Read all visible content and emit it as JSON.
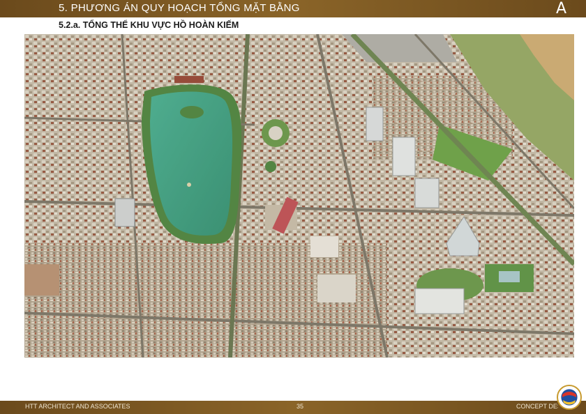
{
  "header": {
    "section_title": "5. PHƯƠNG ÁN QUY HOẠCH TỔNG MẶT BẰNG",
    "logo_letter": "A"
  },
  "subtitle": "5.2.a. TỔNG THỂ KHU VỰC HỒ HOÀN KIẾM",
  "image": {
    "icon": "aerial-city-render",
    "colors": {
      "lake": "#2f9a7a",
      "greenery": "#4f8a3a",
      "roofs": "#c9c2b4",
      "river_bank": "#c7a46a"
    }
  },
  "footer": {
    "company": "HTT ARCHITECT AND ASSOCIATES",
    "page_number": "35",
    "label": "CONCEPT DESIGN",
    "seal_icon": "globe-seal-icon"
  },
  "colors": {
    "bar": "#7a5622",
    "bar_text": "#ffffff"
  }
}
